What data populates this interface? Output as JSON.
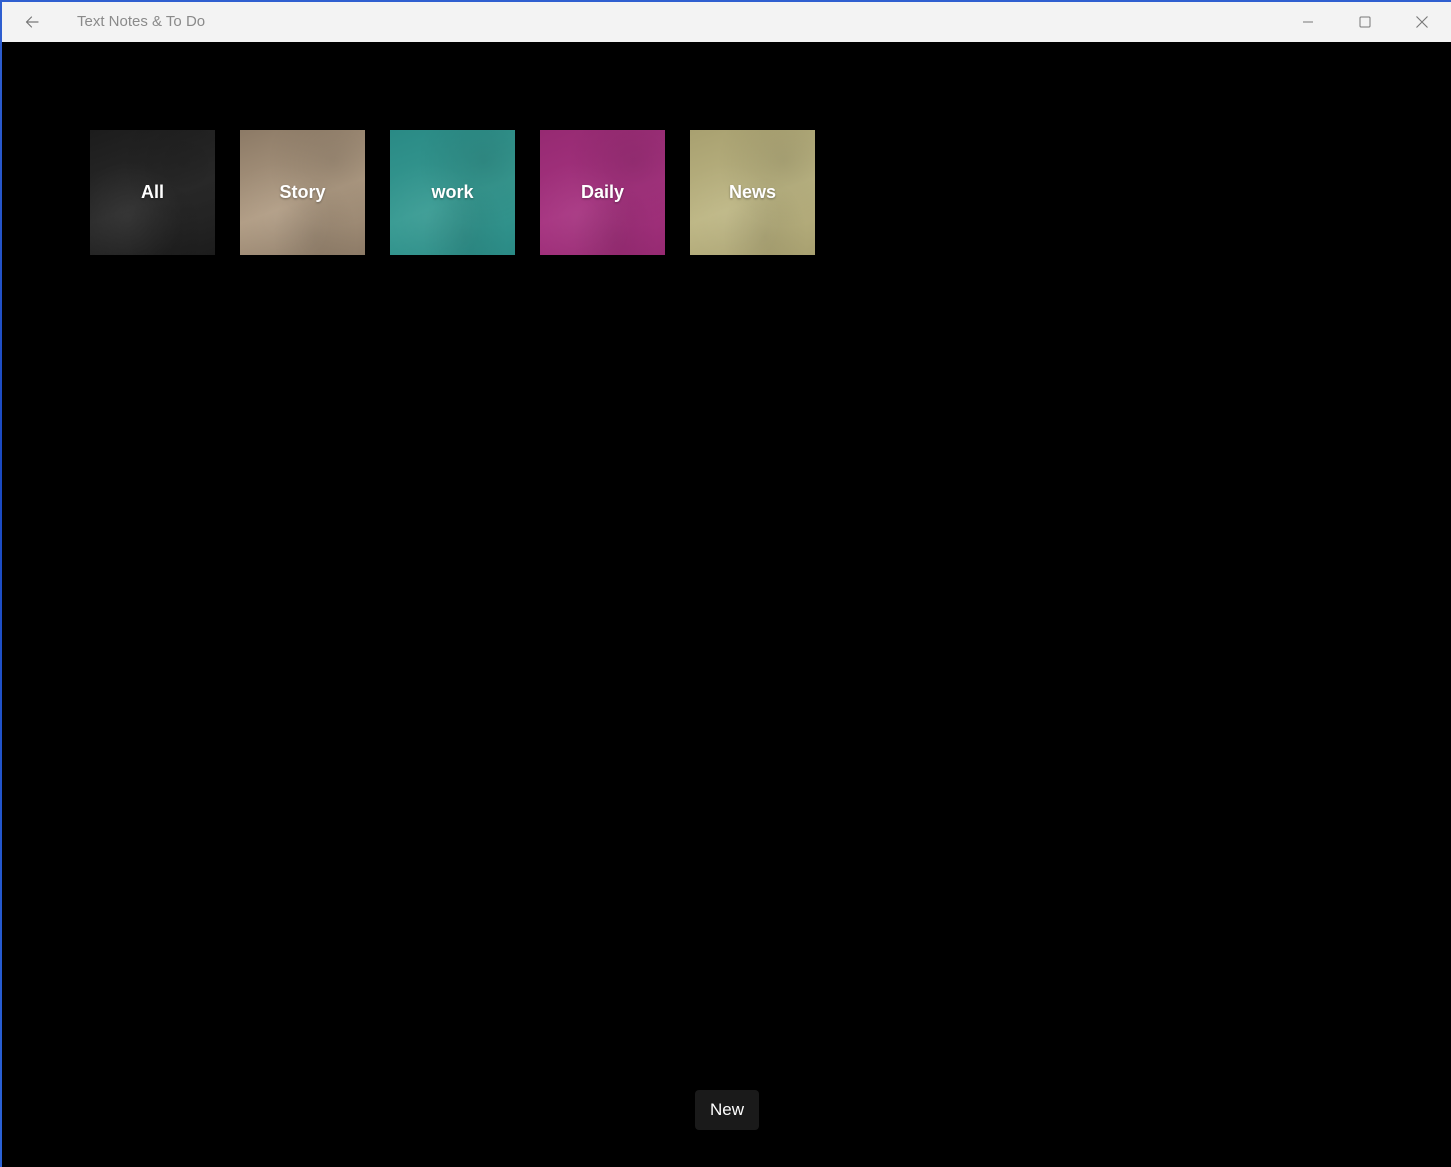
{
  "window": {
    "title": "Text Notes & To Do"
  },
  "icons": {
    "back": "back-arrow-icon",
    "minimize": "minimize-icon",
    "maximize": "maximize-icon",
    "close": "close-icon"
  },
  "categories": [
    {
      "label": "All",
      "color": "#1c1c1c",
      "color_light": "#2a2a2a"
    },
    {
      "label": "Story",
      "color": "#8c7a66",
      "color_light": "#b09c84"
    },
    {
      "label": "work",
      "color": "#2a8a85",
      "color_light": "#379a92"
    },
    {
      "label": "Daily",
      "color": "#962a72",
      "color_light": "#a63380"
    },
    {
      "label": "News",
      "color": "#a8a070",
      "color_light": "#bdb684"
    }
  ],
  "actions": {
    "new_label": "New"
  }
}
